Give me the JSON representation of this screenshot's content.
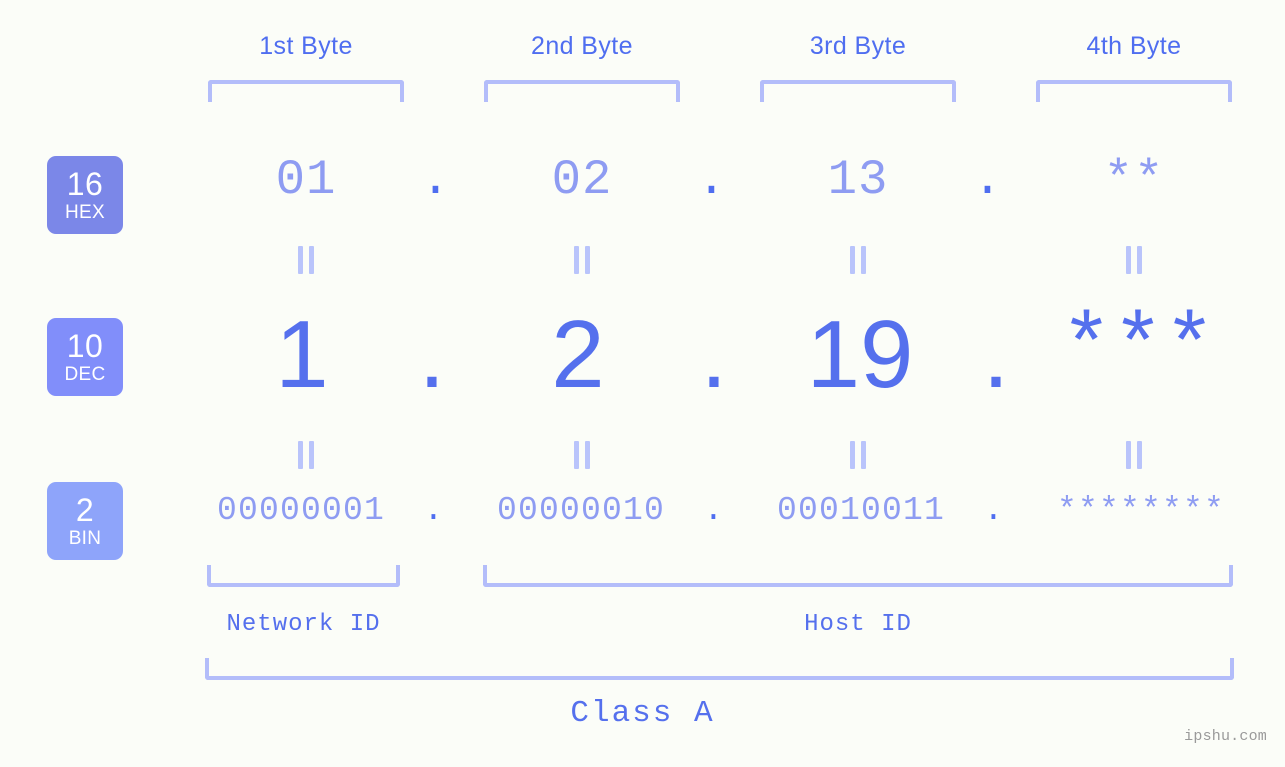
{
  "background_color": "#fbfdf8",
  "accent_color": "#5570ed",
  "accent_light": "#8e9cf2",
  "bracket_color": "#b3bdfa",
  "byte_headers": [
    {
      "label": "1st Byte"
    },
    {
      "label": "2nd Byte"
    },
    {
      "label": "3rd Byte"
    },
    {
      "label": "4th Byte"
    }
  ],
  "radix_badges": [
    {
      "number": "16",
      "label": "HEX",
      "color": "#7b87e8"
    },
    {
      "number": "10",
      "label": "DEC",
      "color": "#818efa"
    },
    {
      "number": "2",
      "label": "BIN",
      "color": "#8ea4fa"
    }
  ],
  "rows": {
    "hex": {
      "radix": "16",
      "radix_label": "HEX",
      "values": [
        "01",
        "02",
        "13",
        "**"
      ],
      "separator": "."
    },
    "dec": {
      "radix": "10",
      "radix_label": "DEC",
      "values": [
        "1",
        "2",
        "19",
        "***"
      ],
      "separator": "."
    },
    "bin": {
      "radix": "2",
      "radix_label": "BIN",
      "values": [
        "00000001",
        "00000010",
        "00010011",
        "********"
      ],
      "separator": "."
    }
  },
  "equality_symbol": "||",
  "id_labels": {
    "network": "Network ID",
    "host": "Host ID"
  },
  "class_label": "Class A",
  "watermark": "ipshu.com"
}
